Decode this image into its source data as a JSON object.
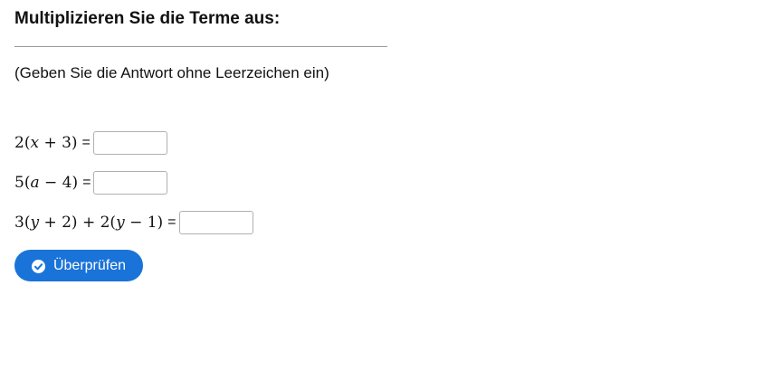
{
  "page": {
    "title": "Multiplizieren Sie die Terme aus:",
    "hint": "(Geben Sie die Antwort ohne Leerzeichen ein)"
  },
  "exercises": [
    {
      "expression_parts": [
        "2(",
        "x",
        " + 3)"
      ],
      "equals": "=",
      "answer_value": ""
    },
    {
      "expression_parts": [
        "5(",
        "a",
        " − 4)"
      ],
      "equals": "=",
      "answer_value": ""
    },
    {
      "expression_parts": [
        "3(",
        "y",
        " + 2) + 2(",
        "y",
        " − 1)"
      ],
      "equals": "=",
      "answer_value": ""
    }
  ],
  "check_button": {
    "label": "Überprüfen",
    "icon": "check-circle-icon"
  },
  "colors": {
    "button_background": "#1a73d9",
    "button_text": "#ffffff",
    "divider": "#999999"
  }
}
